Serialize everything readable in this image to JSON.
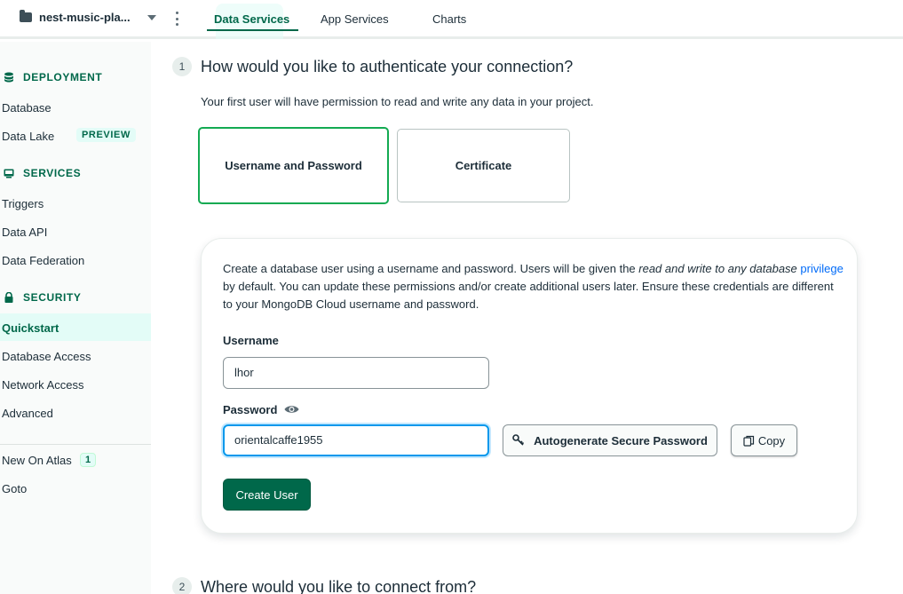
{
  "topbar": {
    "project_name": "nest-music-pla...",
    "tabs": [
      {
        "label": "Data Services"
      },
      {
        "label": "App Services"
      },
      {
        "label": "Charts"
      }
    ]
  },
  "sidebar": {
    "deployment": {
      "heading": "DEPLOYMENT",
      "items": [
        {
          "label": "Database"
        },
        {
          "label": "Data Lake",
          "badge": "PREVIEW"
        }
      ]
    },
    "services": {
      "heading": "SERVICES",
      "items": [
        {
          "label": "Triggers"
        },
        {
          "label": "Data API"
        },
        {
          "label": "Data Federation"
        }
      ]
    },
    "security": {
      "heading": "SECURITY",
      "items": [
        {
          "label": "Quickstart"
        },
        {
          "label": "Database Access"
        },
        {
          "label": "Network Access"
        },
        {
          "label": "Advanced"
        }
      ]
    },
    "extra": [
      {
        "label": "New On Atlas",
        "badge": "1"
      },
      {
        "label": "Goto"
      }
    ]
  },
  "step1": {
    "number": "1",
    "title": "How would you like to authenticate your connection?",
    "subtitle": "Your first user will have permission to read and write any data in your project.",
    "options": [
      "Username and Password",
      "Certificate"
    ]
  },
  "panel": {
    "desc_part1": "Create a database user using a username and password. Users will be given the ",
    "desc_em": "read and write to any database",
    "desc_link": "privilege",
    "desc_part2": " by default. You can update these permissions and/or create additional users later. Ensure these credentials are different to your MongoDB Cloud username and password.",
    "username_label": "Username",
    "username_value": "lhor",
    "password_label": "Password",
    "password_value": "orientalcaffe1955",
    "autogen_label": "Autogenerate Secure Password",
    "copy_label": "Copy",
    "create_label": "Create User"
  },
  "step2": {
    "number": "2",
    "title": "Where would you like to connect from?"
  },
  "colors": {
    "accent": "#00684a",
    "selected_border": "#13aa52",
    "link": "#016bf8",
    "focus": "#0498ec"
  }
}
